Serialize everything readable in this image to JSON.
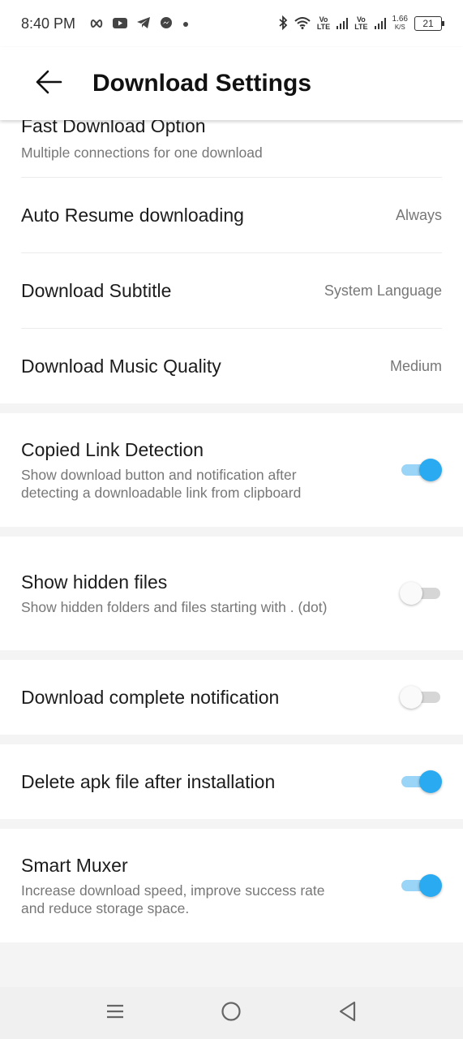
{
  "status_bar": {
    "time": "8:40 PM",
    "network_1": "Vo\nLTE",
    "network_2": "Vo\nLTE",
    "speed_value": "1.66",
    "speed_unit": "K/S",
    "battery": "21"
  },
  "header": {
    "title": "Download Settings"
  },
  "settings": {
    "fast_download": {
      "title": "Fast Download Option",
      "subtitle": "Multiple connections for one download"
    },
    "auto_resume": {
      "title": "Auto Resume downloading",
      "value": "Always"
    },
    "subtitle": {
      "title": "Download Subtitle",
      "value": "System Language"
    },
    "music_quality": {
      "title": "Download Music Quality",
      "value": "Medium"
    },
    "copied_link": {
      "title": "Copied Link Detection",
      "subtitle": "Show download button and notification after detecting a downloadable link from clipboard",
      "enabled": true
    },
    "hidden_files": {
      "title": "Show hidden files",
      "subtitle": "Show hidden folders and files starting with . (dot)",
      "enabled": false
    },
    "complete_notification": {
      "title": "Download complete notification",
      "enabled": false
    },
    "delete_apk": {
      "title": "Delete apk file after installation",
      "enabled": true
    },
    "smart_muxer": {
      "title": "Smart Muxer",
      "subtitle": "Increase download speed, improve success rate and reduce storage space.",
      "enabled": true
    }
  },
  "colors": {
    "accent": "#2aaaf0",
    "accent_track": "#9ad4f6"
  },
  "icons": {
    "back": "arrow-left-icon",
    "nav_menu": "menu-icon",
    "nav_home": "home-circle-icon",
    "nav_back": "triangle-back-icon"
  }
}
